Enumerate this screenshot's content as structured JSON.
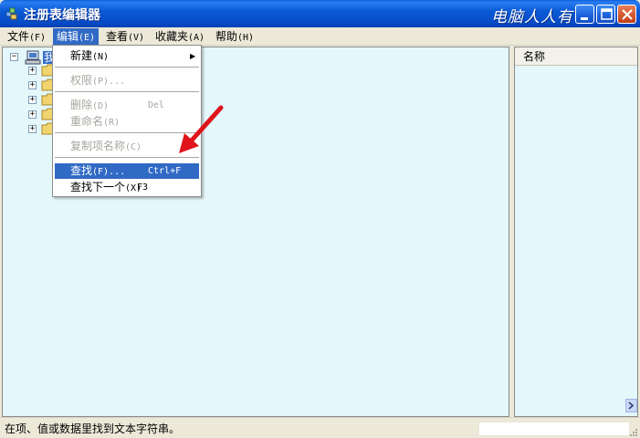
{
  "window": {
    "title": "注册表编辑器",
    "watermark": "电脑人人有"
  },
  "menubar": {
    "items": [
      {
        "label": "文件",
        "accel": "(F)"
      },
      {
        "label": "编辑",
        "accel": "(E)"
      },
      {
        "label": "查看",
        "accel": "(V)"
      },
      {
        "label": "收藏夹",
        "accel": "(A)"
      },
      {
        "label": "帮助",
        "accel": "(H)"
      }
    ],
    "active_index": 1
  },
  "edit_menu": {
    "new": {
      "label": "新建",
      "accel": "(N)"
    },
    "permissions": {
      "label": "权限",
      "accel": "(P)..."
    },
    "delete": {
      "label": "删除",
      "accel": "(D)",
      "shortcut": "Del"
    },
    "rename": {
      "label": "重命名",
      "accel": "(R)"
    },
    "copy_key_name": {
      "label": "复制项名称",
      "accel": "(C)"
    },
    "find": {
      "label": "查找",
      "accel": "(F)...",
      "shortcut": "Ctrl+F"
    },
    "find_next": {
      "label": "查找下一个",
      "accel": "(X)",
      "shortcut": "F3"
    }
  },
  "tree": {
    "root_label": "我",
    "expander_symbol": "⊟",
    "child_expander_symbol": "+",
    "child_count": 5
  },
  "list_pane": {
    "column_name": "名称"
  },
  "statusbar": {
    "text": "在项、值或数据里找到文本字符串。"
  },
  "colors": {
    "pane_background": "#e4f7fb",
    "highlight": "#316ac5",
    "titlebar": "#0b5bd6",
    "arrow": "#e0141b"
  },
  "icons": {
    "app": "regedit-icon",
    "computer": "computer-icon",
    "folder": "folder-icon",
    "annotation": "red-arrow-icon"
  }
}
